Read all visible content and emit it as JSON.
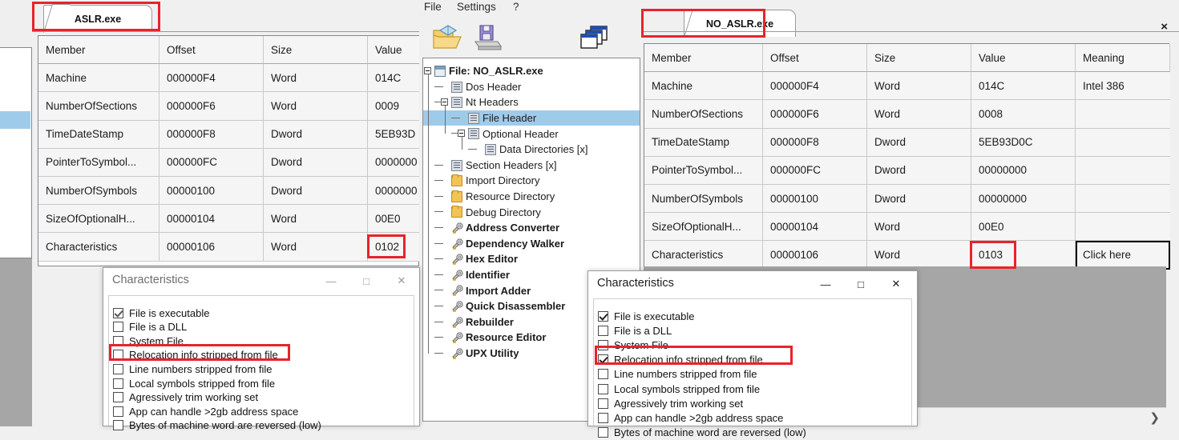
{
  "window_left": {
    "tab_label": "ASLR.exe",
    "table": {
      "columns": [
        "Member",
        "Offset",
        "Size",
        "Value"
      ],
      "rows": [
        {
          "member": "Machine",
          "offset": "000000F4",
          "size": "Word",
          "value": "014C",
          "value_selected": true
        },
        {
          "member": "NumberOfSections",
          "offset": "000000F6",
          "size": "Word",
          "value": "0009",
          "value_selected": false
        },
        {
          "member": "TimeDateStamp",
          "offset": "000000F8",
          "size": "Dword",
          "value": "5EB93D",
          "value_selected": false
        },
        {
          "member": "PointerToSymbol...",
          "offset": "000000FC",
          "size": "Dword",
          "value": "0000000",
          "value_selected": false
        },
        {
          "member": "NumberOfSymbols",
          "offset": "00000100",
          "size": "Dword",
          "value": "0000000",
          "value_selected": false
        },
        {
          "member": "SizeOfOptionalH...",
          "offset": "00000104",
          "size": "Word",
          "value": "00E0",
          "value_selected": false
        },
        {
          "member": "Characteristics",
          "offset": "00000106",
          "size": "Word",
          "value": "0102",
          "value_selected": true
        }
      ]
    },
    "highlight_value": "0102"
  },
  "window_center": {
    "menu": [
      "File",
      "Settings",
      "?"
    ],
    "toolbar": [
      {
        "name": "open-file-icon",
        "title": "Open"
      },
      {
        "name": "save-file-icon",
        "title": "Save"
      },
      {
        "name": "compare-files-icon",
        "title": "Compare"
      }
    ],
    "tree": [
      {
        "label": "File: NO_ASLR.exe",
        "depth": 0,
        "icon": "window-icon",
        "bold": true,
        "selected": false,
        "expander": "collapse"
      },
      {
        "label": "Dos Header",
        "depth": 1,
        "icon": "page-icon",
        "bold": false,
        "selected": false,
        "expander": "none"
      },
      {
        "label": "Nt Headers",
        "depth": 1,
        "icon": "page-icon",
        "bold": false,
        "selected": false,
        "expander": "collapse"
      },
      {
        "label": "File Header",
        "depth": 2,
        "icon": "page-icon",
        "bold": false,
        "selected": true,
        "expander": "none"
      },
      {
        "label": "Optional Header",
        "depth": 2,
        "icon": "page-icon",
        "bold": false,
        "selected": false,
        "expander": "collapse"
      },
      {
        "label": "Data Directories [x]",
        "depth": 3,
        "icon": "page-icon",
        "bold": false,
        "selected": false,
        "expander": "none"
      },
      {
        "label": "Section Headers [x]",
        "depth": 1,
        "icon": "page-icon",
        "bold": false,
        "selected": false,
        "expander": "none"
      },
      {
        "label": "Import Directory",
        "depth": 1,
        "icon": "folder-icon",
        "bold": false,
        "selected": false,
        "expander": "none"
      },
      {
        "label": "Resource Directory",
        "depth": 1,
        "icon": "folder-icon",
        "bold": false,
        "selected": false,
        "expander": "none"
      },
      {
        "label": "Debug Directory",
        "depth": 1,
        "icon": "folder-icon",
        "bold": false,
        "selected": false,
        "expander": "none"
      },
      {
        "label": "Address Converter",
        "depth": 1,
        "icon": "tool-icon",
        "bold": true,
        "selected": false,
        "expander": "none"
      },
      {
        "label": "Dependency Walker",
        "depth": 1,
        "icon": "tool-icon",
        "bold": true,
        "selected": false,
        "expander": "none"
      },
      {
        "label": "Hex Editor",
        "depth": 1,
        "icon": "tool-icon",
        "bold": true,
        "selected": false,
        "expander": "none"
      },
      {
        "label": "Identifier",
        "depth": 1,
        "icon": "tool-icon",
        "bold": true,
        "selected": false,
        "expander": "none"
      },
      {
        "label": "Import Adder",
        "depth": 1,
        "icon": "tool-icon",
        "bold": true,
        "selected": false,
        "expander": "none"
      },
      {
        "label": "Quick Disassembler",
        "depth": 1,
        "icon": "tool-icon",
        "bold": true,
        "selected": false,
        "expander": "none"
      },
      {
        "label": "Rebuilder",
        "depth": 1,
        "icon": "tool-icon",
        "bold": true,
        "selected": false,
        "expander": "none"
      },
      {
        "label": "Resource Editor",
        "depth": 1,
        "icon": "tool-icon",
        "bold": true,
        "selected": false,
        "expander": "none"
      },
      {
        "label": "UPX Utility",
        "depth": 1,
        "icon": "tool-icon",
        "bold": true,
        "selected": false,
        "expander": "none"
      }
    ]
  },
  "window_right": {
    "tab_label": "NO_ASLR.exe",
    "close_label": "×",
    "scroll_right_label": "❯",
    "table": {
      "columns": [
        "Member",
        "Offset",
        "Size",
        "Value",
        "Meaning"
      ],
      "rows": [
        {
          "member": "Machine",
          "offset": "000000F4",
          "size": "Word",
          "value": "014C",
          "meaning": "Intel 386",
          "row_selected": true,
          "meaning_focus": false
        },
        {
          "member": "NumberOfSections",
          "offset": "000000F6",
          "size": "Word",
          "value": "0008",
          "meaning": "",
          "row_selected": false,
          "meaning_focus": false
        },
        {
          "member": "TimeDateStamp",
          "offset": "000000F8",
          "size": "Dword",
          "value": "5EB93D0C",
          "meaning": "",
          "row_selected": false,
          "meaning_focus": false
        },
        {
          "member": "PointerToSymbol...",
          "offset": "000000FC",
          "size": "Dword",
          "value": "00000000",
          "meaning": "",
          "row_selected": false,
          "meaning_focus": false
        },
        {
          "member": "NumberOfSymbols",
          "offset": "00000100",
          "size": "Dword",
          "value": "00000000",
          "meaning": "",
          "row_selected": false,
          "meaning_focus": false
        },
        {
          "member": "SizeOfOptionalH...",
          "offset": "00000104",
          "size": "Word",
          "value": "00E0",
          "meaning": "",
          "row_selected": false,
          "meaning_focus": false
        },
        {
          "member": "Characteristics",
          "offset": "00000106",
          "size": "Word",
          "value": "0103",
          "meaning": "Click here",
          "row_selected": true,
          "meaning_focus": true
        }
      ]
    },
    "highlight_value": "0103"
  },
  "dialog_left": {
    "title": "Characteristics",
    "minimize_label": "—",
    "maximize_label": "□",
    "close_label": "✕",
    "items": [
      {
        "label": "File is executable",
        "checked": true
      },
      {
        "label": "File is a DLL",
        "checked": false
      },
      {
        "label": "System File",
        "checked": false
      },
      {
        "label": "Relocation info stripped from file",
        "checked": false
      },
      {
        "label": "Line numbers stripped from file",
        "checked": false
      },
      {
        "label": "Local symbols stripped from file",
        "checked": false
      },
      {
        "label": "Agressively trim working set",
        "checked": false
      },
      {
        "label": "App can handle >2gb address space",
        "checked": false
      },
      {
        "label": "Bytes of machine word are reversed (low)",
        "checked": false
      }
    ],
    "highlighted_item": "Relocation info stripped from file"
  },
  "dialog_right": {
    "title": "Characteristics",
    "minimize_label": "—",
    "maximize_label": "□",
    "close_label": "✕",
    "items": [
      {
        "label": "File is executable",
        "checked": true
      },
      {
        "label": "File is a DLL",
        "checked": false
      },
      {
        "label": "System File",
        "checked": false
      },
      {
        "label": "Relocation info stripped from file",
        "checked": true
      },
      {
        "label": "Line numbers stripped from file",
        "checked": false
      },
      {
        "label": "Local symbols stripped from file",
        "checked": false
      },
      {
        "label": "Agressively trim working set",
        "checked": false
      },
      {
        "label": "App can handle >2gb address space",
        "checked": false
      },
      {
        "label": "Bytes of machine word are reversed (low)",
        "checked": false
      }
    ],
    "highlighted_item": "Relocation info stripped from file"
  },
  "annotations": {
    "color": "#e8232a",
    "boxes": [
      "left-tab",
      "left-characteristics-value",
      "right-tab",
      "right-characteristics-value",
      "left-dialog-relocation-row",
      "right-dialog-relocation-row"
    ]
  }
}
